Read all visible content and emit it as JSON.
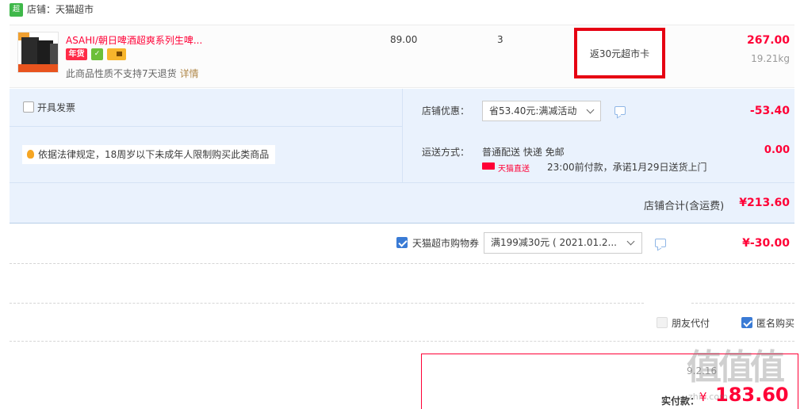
{
  "shop": {
    "logo_text": "超市",
    "name": "店铺：天猫超市"
  },
  "product": {
    "title": "ASAHI/朝日啤酒超爽系列生啤...",
    "badge_nianhuo": "年货",
    "return_note": "此商品性质不支持7天退货",
    "detail_link": "详情",
    "unit_price": "89.00",
    "quantity": "3",
    "rebate": "返30元超市卡",
    "subtotal": "267.00",
    "weight": "19.21kg"
  },
  "invoice": {
    "label": "开具发票",
    "checked": false
  },
  "notice": "依据法律规定，18周岁以下未成年人限制购买此类商品",
  "shop_promo": {
    "label": "店铺优惠：",
    "selected": "省53.40元:满减活动",
    "amount": "-53.40"
  },
  "shipping": {
    "label": "运送方式：",
    "method": "普通配送 快递 免邮",
    "tmall_direct": "天猫直送",
    "promise": "23:00前付款，承诺1月29日送货上门",
    "amount": "0.00"
  },
  "shop_total": {
    "label": "店铺合计(含运费)",
    "value": "¥213.60"
  },
  "coupon": {
    "checked": true,
    "label": "天猫超市购物券",
    "selected": "满199减30元 ( 2021.01.2...",
    "amount": "¥-30.00"
  },
  "options": {
    "friend_pay": {
      "label": "朋友代付",
      "checked": false,
      "enabled": false
    },
    "anonymous": {
      "label": "匿名购买",
      "checked": true
    }
  },
  "payment": {
    "label": "实付款：",
    "currency": "¥",
    "amount": "183.60",
    "date_fragment": "9.2.16"
  },
  "watermark": {
    "text": "值值值",
    "url": "zhi...com"
  },
  "colors": {
    "accent_red": "#ff0036",
    "panel_blue": "#eaf2fd",
    "checkbox_blue": "#3a7bd5",
    "rebate_border": "#e60012"
  }
}
